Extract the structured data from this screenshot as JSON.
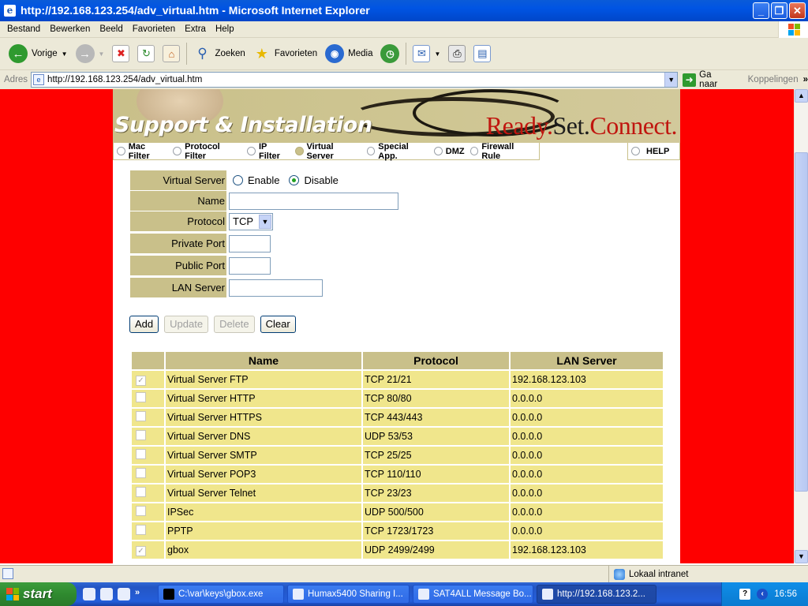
{
  "window": {
    "title": "http://192.168.123.254/adv_virtual.htm - Microsoft Internet Explorer"
  },
  "menu": [
    "Bestand",
    "Bewerken",
    "Beeld",
    "Favorieten",
    "Extra",
    "Help"
  ],
  "toolbar": {
    "back": "Vorige",
    "search": "Zoeken",
    "favorites": "Favorieten",
    "media": "Media"
  },
  "address": {
    "label": "Adres",
    "url": "http://192.168.123.254/adv_virtual.htm",
    "go": "Ga naar",
    "links": "Koppelingen"
  },
  "banner": {
    "title": "Support & Installation",
    "tag1": "Ready.",
    "tag2": "Set.",
    "tag3": "Connect."
  },
  "tabs": [
    "Mac Filter",
    "Protocol Filter",
    "IP Filter",
    "Virtual Server",
    "Special App.",
    "DMZ",
    "Firewall Rule"
  ],
  "help": "HELP",
  "form": {
    "virtual_server_label": "Virtual Server",
    "enable": "Enable",
    "disable": "Disable",
    "name_label": "Name",
    "protocol_label": "Protocol",
    "protocol_value": "TCP",
    "private_port_label": "Private Port",
    "public_port_label": "Public Port",
    "lan_server_label": "LAN Server"
  },
  "buttons": {
    "add": "Add",
    "update": "Update",
    "delete": "Delete",
    "clear": "Clear"
  },
  "table": {
    "headers": [
      "Name",
      "Protocol",
      "LAN Server"
    ],
    "rows": [
      {
        "name": "Virtual Server FTP",
        "protocol": "TCP 21/21",
        "lan": "192.168.123.103",
        "checked": true
      },
      {
        "name": "Virtual Server HTTP",
        "protocol": "TCP 80/80",
        "lan": "0.0.0.0",
        "checked": false
      },
      {
        "name": "Virtual Server HTTPS",
        "protocol": "TCP 443/443",
        "lan": "0.0.0.0",
        "checked": false
      },
      {
        "name": "Virtual Server DNS",
        "protocol": "UDP 53/53",
        "lan": "0.0.0.0",
        "checked": false
      },
      {
        "name": "Virtual Server SMTP",
        "protocol": "TCP 25/25",
        "lan": "0.0.0.0",
        "checked": false
      },
      {
        "name": "Virtual Server POP3",
        "protocol": "TCP 110/110",
        "lan": "0.0.0.0",
        "checked": false
      },
      {
        "name": "Virtual Server Telnet",
        "protocol": "TCP 23/23",
        "lan": "0.0.0.0",
        "checked": false
      },
      {
        "name": "IPSec",
        "protocol": "UDP 500/500",
        "lan": "0.0.0.0",
        "checked": false
      },
      {
        "name": "PPTP",
        "protocol": "TCP 1723/1723",
        "lan": "0.0.0.0",
        "checked": false
      },
      {
        "name": "gbox",
        "protocol": "UDP 2499/2499",
        "lan": "192.168.123.103",
        "checked": true
      }
    ]
  },
  "status": {
    "zone": "Lokaal intranet"
  },
  "taskbar": {
    "start": "start",
    "tasks": [
      "C:\\var\\keys\\gbox.exe",
      "Humax5400 Sharing I...",
      "SAT4ALL Message Bo...",
      "http://192.168.123.2..."
    ],
    "clock": "16:56"
  },
  "colors": {
    "accent_red": "#fe0000",
    "khaki": "#c9c08a",
    "row_yellow": "#f0e68c"
  }
}
